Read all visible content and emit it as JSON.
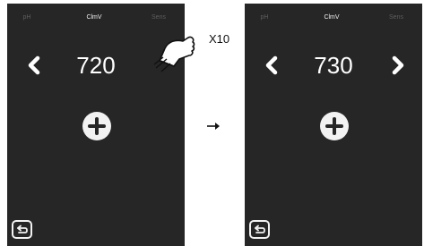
{
  "tabs": [
    "pH",
    "ClmV",
    "Sens"
  ],
  "active_tab": "ClmV",
  "screens": [
    {
      "value": "720",
      "has_right_arrow": false
    },
    {
      "value": "730",
      "has_right_arrow": true
    }
  ],
  "gesture": {
    "repeat_label": "X10",
    "icon": "tap-hand-icon"
  },
  "icons": {
    "decrease": "chevron-left-icon",
    "increase": "chevron-right-icon",
    "plus": "plus-icon",
    "back": "back-return-icon",
    "transition": "arrow-right-icon"
  },
  "colors": {
    "screen_background": "#262626",
    "active_tab_text": "#f2f2f2",
    "inactive_tab_text": "#5e5e5e",
    "foreground": "#ffffff"
  }
}
